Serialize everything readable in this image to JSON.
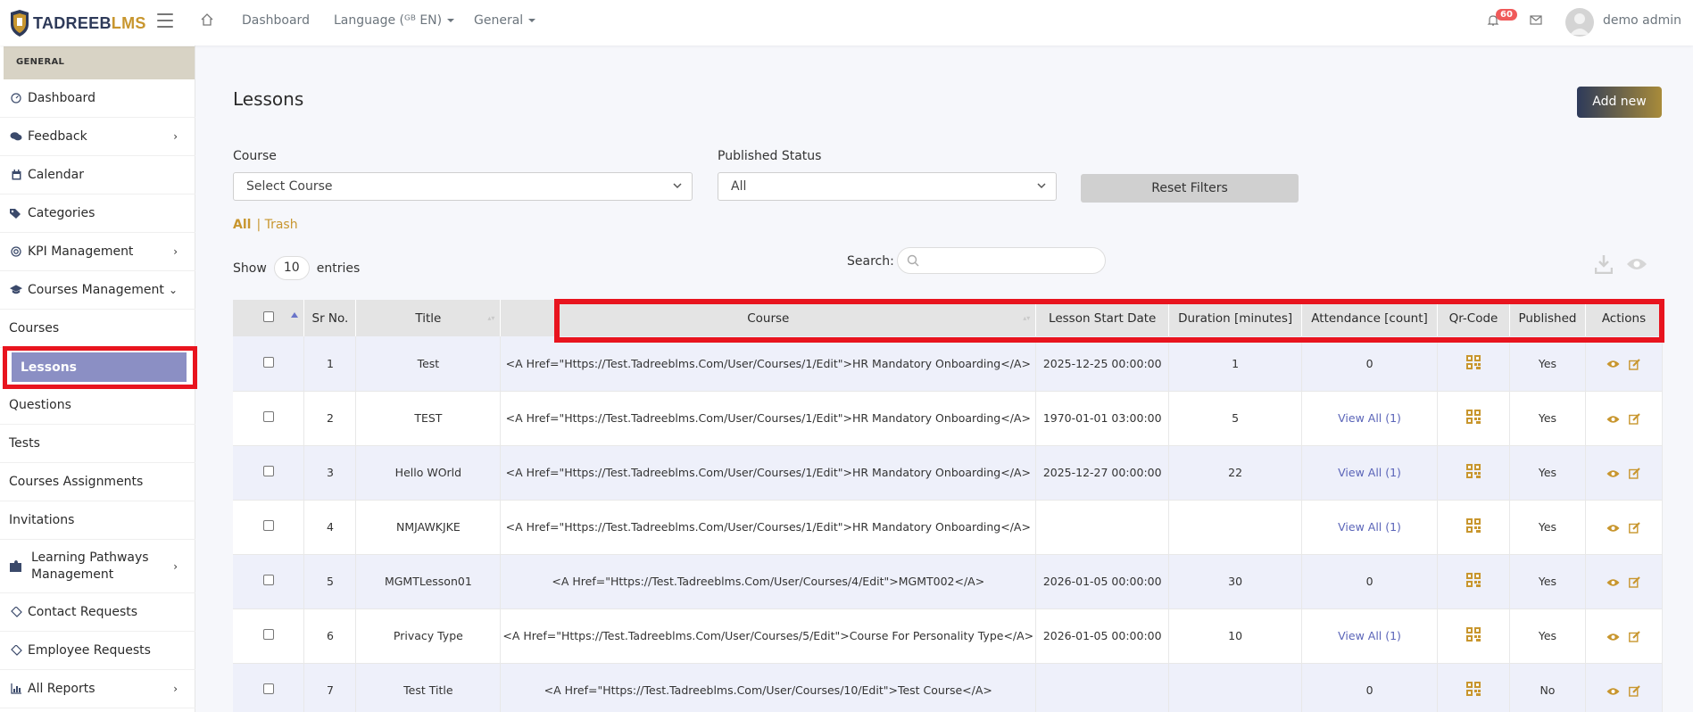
{
  "brand": {
    "part1": "TADREEB",
    "part2": "LMS"
  },
  "topnav": {
    "dashboard": "Dashboard",
    "language": "Language (ᴳᴮ EN)",
    "general": "General",
    "notifications_count": "60",
    "username": "demo admin"
  },
  "sidebar": {
    "section": "GENERAL",
    "items": [
      {
        "label": "Dashboard",
        "icon": "gauge-icon"
      },
      {
        "label": "Feedback",
        "icon": "comments-icon"
      },
      {
        "label": "Calendar",
        "icon": "calendar-icon"
      },
      {
        "label": "Categories",
        "icon": "tags-icon"
      },
      {
        "label": "KPI Management",
        "icon": "target-icon"
      },
      {
        "label": "Courses Management",
        "icon": "graduation-cap-icon"
      },
      {
        "label": "Courses"
      },
      {
        "label": "Lessons"
      },
      {
        "label": "Questions"
      },
      {
        "label": "Tests"
      },
      {
        "label": "Courses Assignments"
      },
      {
        "label": "Invitations"
      },
      {
        "label": "Learning Pathways Management",
        "icon": "puzzle-icon"
      },
      {
        "label": "Contact Requests",
        "icon": "handshake-icon"
      },
      {
        "label": "Employee Requests",
        "icon": "handshake-icon"
      },
      {
        "label": "All Reports",
        "icon": "chart-icon"
      }
    ]
  },
  "page": {
    "title": "Lessons",
    "add_new": "Add new",
    "course_label": "Course",
    "course_value": "Select Course",
    "status_label": "Published Status",
    "status_value": "All",
    "reset": "Reset Filters",
    "tab_all": "All",
    "tab_trash": "| Trash",
    "show": "Show",
    "entries_value": "10",
    "entries": "entries",
    "search_label": "Search:"
  },
  "table": {
    "headers": [
      "Sr No.",
      "Title",
      "Course",
      "Lesson Start Date",
      "Duration [minutes]",
      "Attendance [count]",
      "Qr-Code",
      "Published",
      "Actions"
    ],
    "rows": [
      {
        "sr": "1",
        "title": "Test",
        "course": "<A Href=\"Https://Test.Tadreeblms.Com/User/Courses/1/Edit\">HR Mandatory Onboarding</A>",
        "start": "2025-12-25 00:00:00",
        "duration": "1",
        "attendance": "0",
        "published": "Yes"
      },
      {
        "sr": "2",
        "title": "TEST",
        "course": "<A Href=\"Https://Test.Tadreeblms.Com/User/Courses/1/Edit\">HR Mandatory Onboarding</A>",
        "start": "1970-01-01 03:00:00",
        "duration": "5",
        "attendance": "View All (1)",
        "published": "Yes"
      },
      {
        "sr": "3",
        "title": "Hello WOrld",
        "course": "<A Href=\"Https://Test.Tadreeblms.Com/User/Courses/1/Edit\">HR Mandatory Onboarding</A>",
        "start": "2025-12-27 00:00:00",
        "duration": "22",
        "attendance": "View All (1)",
        "published": "Yes"
      },
      {
        "sr": "4",
        "title": "NMJAWKJKE",
        "course": "<A Href=\"Https://Test.Tadreeblms.Com/User/Courses/1/Edit\">HR Mandatory Onboarding</A>",
        "start": "",
        "duration": "",
        "attendance": "View All (1)",
        "published": "Yes"
      },
      {
        "sr": "5",
        "title": "MGMTLesson01",
        "course": "<A Href=\"Https://Test.Tadreeblms.Com/User/Courses/4/Edit\">MGMT002</A>",
        "start": "2026-01-05 00:00:00",
        "duration": "30",
        "attendance": "0",
        "published": "Yes"
      },
      {
        "sr": "6",
        "title": "Privacy Type",
        "course": "<A Href=\"Https://Test.Tadreeblms.Com/User/Courses/5/Edit\">Course For Personality Type</A>",
        "start": "2026-01-05 00:00:00",
        "duration": "10",
        "attendance": "View All (1)",
        "published": "Yes"
      },
      {
        "sr": "7",
        "title": "Test Title",
        "course": "<A Href=\"Https://Test.Tadreeblms.Com/User/Courses/10/Edit\">Test Course</A>",
        "start": "",
        "duration": "",
        "attendance": "0",
        "published": "No"
      }
    ]
  },
  "colors": {
    "accent": "#c8962e",
    "active_nav": "#8b8fc4",
    "highlight": "#e8141e",
    "link": "#5a64b8"
  }
}
